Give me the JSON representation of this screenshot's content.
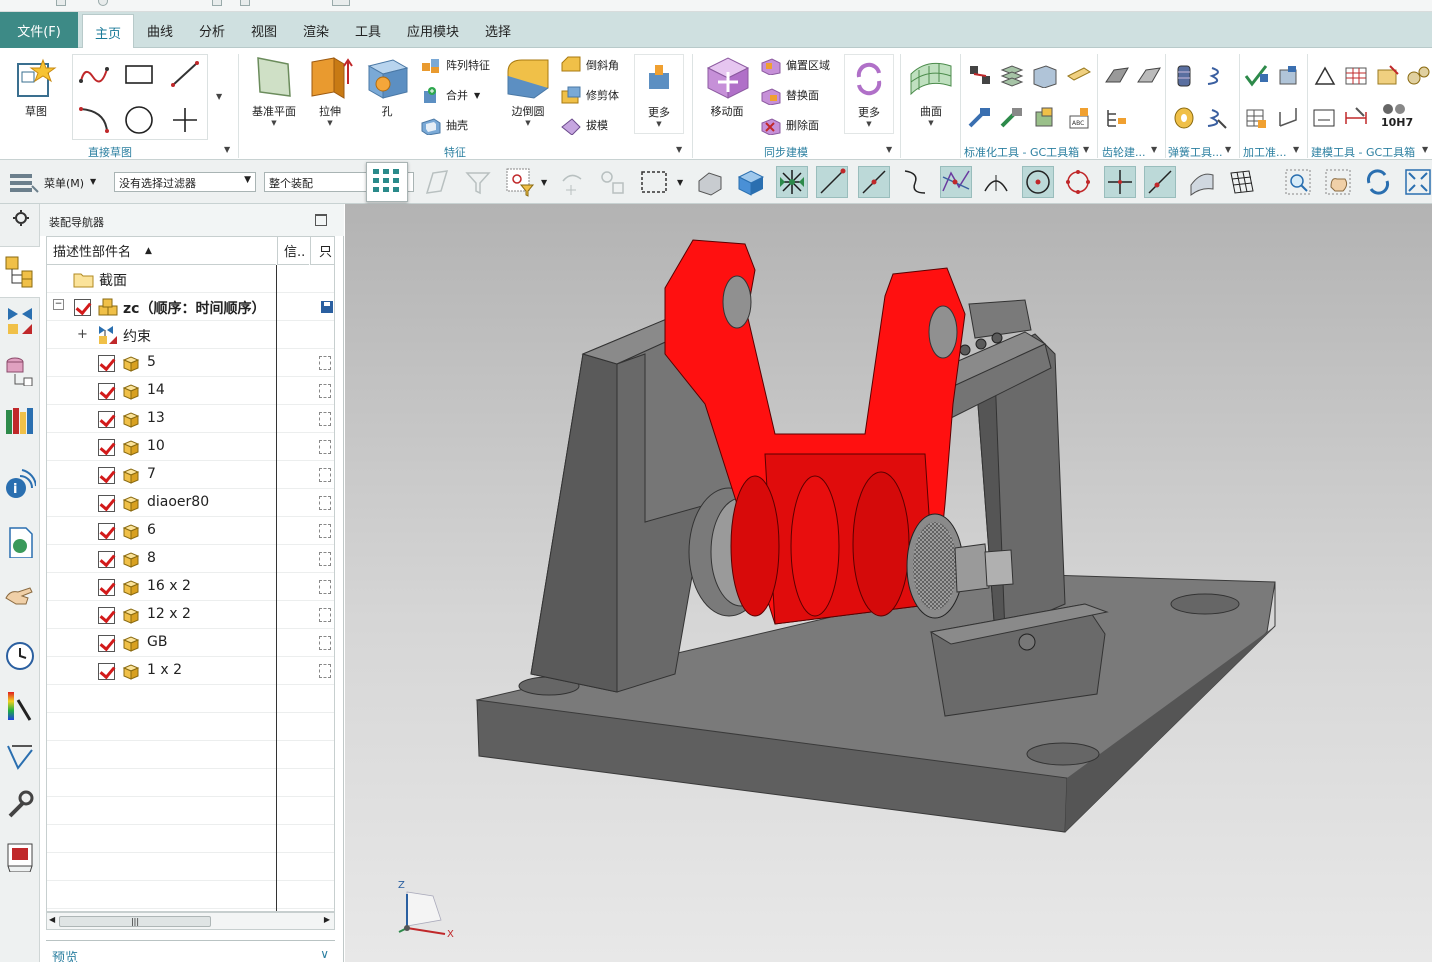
{
  "menu": {
    "file": "文件(F)",
    "tabs": [
      "主页",
      "曲线",
      "分析",
      "视图",
      "渲染",
      "工具",
      "应用模块",
      "选择"
    ]
  },
  "ribbon": {
    "sketch": "草图",
    "direct_sketch_group": "直接草图",
    "datum_plane": "基准平面",
    "extrude": "拉伸",
    "hole": "孔",
    "pattern_feature": "阵列特征",
    "combine": "合并",
    "shell": "抽壳",
    "edge_blend": "边倒圆",
    "chamfer": "倒斜角",
    "trim_body": "修剪体",
    "draft": "拔模",
    "more": "更多",
    "feature_group": "特征",
    "move_face": "移动面",
    "offset_region": "偏置区域",
    "replace_face": "替换面",
    "delete_face": "删除面",
    "sync_more": "更多",
    "sync_group": "同步建模",
    "surface": "曲面",
    "std_tools_group": "标准化工具 - GC工具箱",
    "gear_group": "齿轮建...",
    "spring_group": "弹簧工具...",
    "machining_group": "加工准...",
    "modeling_tools_group": "建模工具 - GC工具箱",
    "tolerance_label": "10H7"
  },
  "toolbar": {
    "menu_label": "菜单(M)",
    "filter": "没有选择过滤器",
    "scope": "整个装配"
  },
  "navigator": {
    "title": "装配导航器",
    "col_name": "描述性部件名",
    "col_info": "信..",
    "col_ro": "只",
    "section": "截面",
    "root": "zc（顺序：时间顺序）",
    "constraints": "约束",
    "parts": [
      "5",
      "14",
      "13",
      "10",
      "7",
      "diaoer80",
      "6",
      "8",
      "16 x 2",
      "12 x 2",
      "GB",
      "1 x 2"
    ],
    "preview": "预览"
  },
  "viewport": {
    "axis_z": "Z",
    "axis_x": "X"
  },
  "colors": {
    "accent": "#3d8a86",
    "menubar": "#cfe0e0",
    "group_label": "#2b7fa0",
    "part_red": "#ff1010",
    "part_gray": "#6e6e6e"
  }
}
